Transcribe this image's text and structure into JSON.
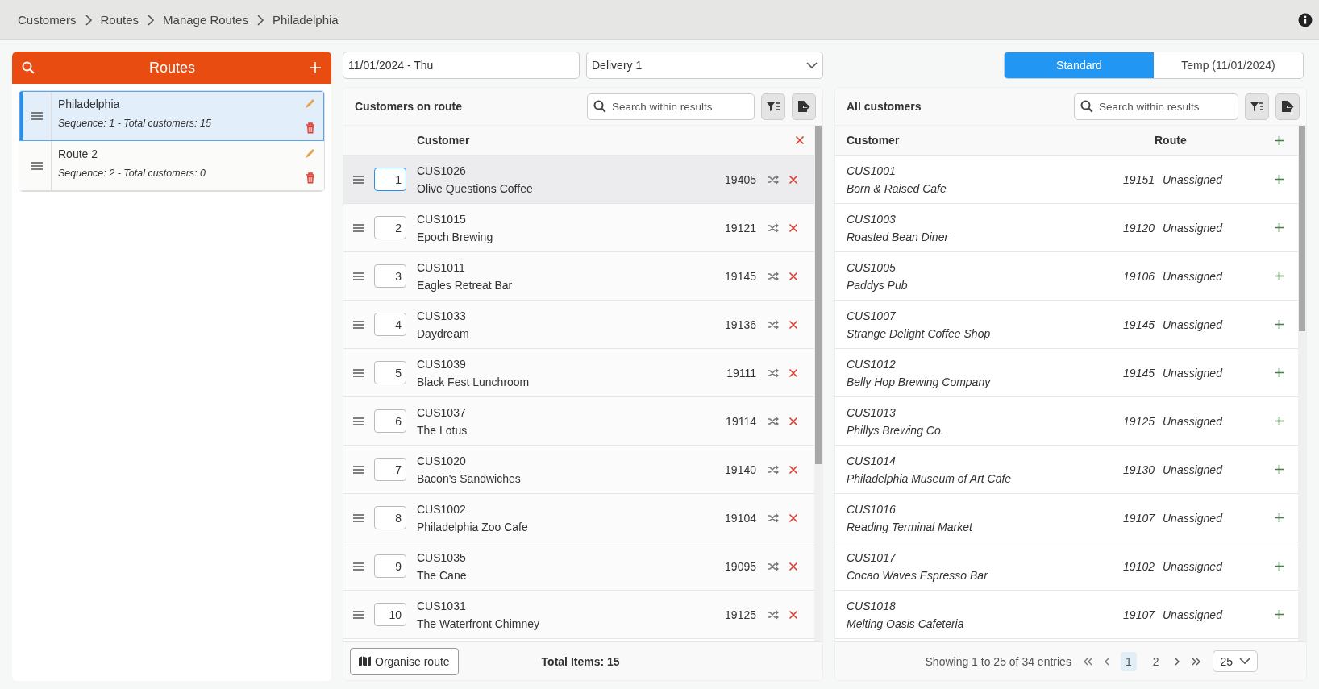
{
  "breadcrumbs": [
    "Customers",
    "Routes",
    "Manage Routes",
    "Philadelphia"
  ],
  "routes_panel": {
    "title": "Routes",
    "routes": [
      {
        "name": "Philadelphia",
        "detail": "Sequence: 1 - Total customers: 15",
        "selected": true
      },
      {
        "name": "Route 2",
        "detail": "Sequence: 2 - Total customers: 0",
        "selected": false
      }
    ]
  },
  "date_field": {
    "value": "11/01/2024 - Thu"
  },
  "delivery_select": {
    "value": "Delivery 1"
  },
  "mode_tabs": [
    {
      "label": "Standard",
      "selected": true
    },
    {
      "label": "Temp (11/01/2024)",
      "selected": false
    }
  ],
  "route_customers": {
    "title": "Customers on route",
    "search": {
      "placeholder": "Search within results"
    },
    "column": "Customer",
    "rows": [
      {
        "seq": "1",
        "code": "CUS1026",
        "name": "Olive Questions Coffee",
        "zip": "19405",
        "selected": true
      },
      {
        "seq": "2",
        "code": "CUS1015",
        "name": "Epoch Brewing",
        "zip": "19121",
        "selected": false
      },
      {
        "seq": "3",
        "code": "CUS1011",
        "name": "Eagles Retreat Bar",
        "zip": "19145",
        "selected": false
      },
      {
        "seq": "4",
        "code": "CUS1033",
        "name": "Daydream",
        "zip": "19136",
        "selected": false
      },
      {
        "seq": "5",
        "code": "CUS1039",
        "name": "Black Fest Lunchroom",
        "zip": "19111",
        "selected": false
      },
      {
        "seq": "6",
        "code": "CUS1037",
        "name": "The Lotus",
        "zip": "19114",
        "selected": false
      },
      {
        "seq": "7",
        "code": "CUS1020",
        "name": "Bacon's Sandwiches",
        "zip": "19140",
        "selected": false
      },
      {
        "seq": "8",
        "code": "CUS1002",
        "name": "Philadelphia Zoo Cafe",
        "zip": "19104",
        "selected": false
      },
      {
        "seq": "9",
        "code": "CUS1035",
        "name": "The Cane",
        "zip": "19095",
        "selected": false
      },
      {
        "seq": "10",
        "code": "CUS1031",
        "name": "The Waterfront Chimney",
        "zip": "19125",
        "selected": false
      }
    ],
    "organise_button": "Organise route",
    "total": "Total Items: 15"
  },
  "all_customers": {
    "title": "All customers",
    "search": {
      "placeholder": "Search within results"
    },
    "columns": [
      "Customer",
      "Route"
    ],
    "rows": [
      {
        "code": "CUS1001",
        "name": "Born & Raised Cafe",
        "zip": "19151",
        "route": "Unassigned"
      },
      {
        "code": "CUS1003",
        "name": "Roasted Bean Diner",
        "zip": "19120",
        "route": "Unassigned"
      },
      {
        "code": "CUS1005",
        "name": "Paddys Pub",
        "zip": "19106",
        "route": "Unassigned"
      },
      {
        "code": "CUS1007",
        "name": "Strange Delight Coffee Shop",
        "zip": "19145",
        "route": "Unassigned"
      },
      {
        "code": "CUS1012",
        "name": "Belly Hop Brewing Company",
        "zip": "19145",
        "route": "Unassigned"
      },
      {
        "code": "CUS1013",
        "name": "Phillys Brewing Co.",
        "zip": "19125",
        "route": "Unassigned"
      },
      {
        "code": "CUS1014",
        "name": "Philadelphia Museum of Art Cafe",
        "zip": "19130",
        "route": "Unassigned"
      },
      {
        "code": "CUS1016",
        "name": "Reading Terminal Market",
        "zip": "19107",
        "route": "Unassigned"
      },
      {
        "code": "CUS1017",
        "name": "Cocao Waves Espresso Bar",
        "zip": "19102",
        "route": "Unassigned"
      },
      {
        "code": "CUS1018",
        "name": "Melting Oasis Cafeteria",
        "zip": "19107",
        "route": "Unassigned"
      }
    ],
    "pagination": {
      "summary": "Showing 1 to 25 of 34 entries",
      "pages": [
        {
          "label": "1",
          "selected": true
        },
        {
          "label": "2",
          "selected": false
        }
      ],
      "page_size": "25"
    }
  }
}
